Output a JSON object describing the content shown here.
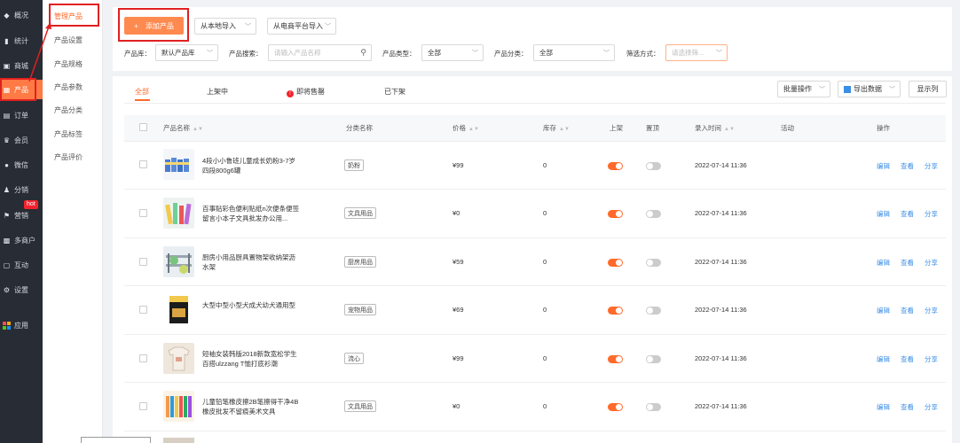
{
  "sidebar": {
    "items": [
      {
        "label": "概况",
        "icon": "layers-icon"
      },
      {
        "label": "统计",
        "icon": "chart-icon"
      },
      {
        "label": "商城",
        "icon": "store-icon"
      },
      {
        "label": "产品",
        "icon": "grid-icon",
        "active": true
      },
      {
        "label": "订单",
        "icon": "order-icon"
      },
      {
        "label": "会员",
        "icon": "crown-icon"
      },
      {
        "label": "微信",
        "icon": "wechat-icon"
      },
      {
        "label": "分销",
        "icon": "users-icon"
      },
      {
        "label": "营销",
        "icon": "flag-icon"
      },
      {
        "label": "多商户",
        "icon": "shop-icon"
      },
      {
        "label": "互动",
        "icon": "chat-icon"
      },
      {
        "label": "设置",
        "icon": "gear-icon"
      },
      {
        "label": "应用",
        "icon": "apps-icon"
      }
    ],
    "hot_badge": "hot"
  },
  "subnav": {
    "items": [
      "管理产品",
      "产品设置",
      "产品规格",
      "产品参数",
      "产品分类",
      "产品标签",
      "产品评价"
    ]
  },
  "toolbar": {
    "add_label": "添加产品",
    "import_local": "从本地导入",
    "import_ecommerce": "从电商平台导入"
  },
  "filters": {
    "library_label": "产品库：",
    "library_value": "默认产品库",
    "search_label": "产品搜索：",
    "search_placeholder": "请输入产品名称",
    "type_label": "产品类型：",
    "type_value": "全部",
    "category_label": "产品分类：",
    "category_value": "全部",
    "filter_label": "筛选方式：",
    "filter_placeholder": "请选择筛..."
  },
  "tabs": [
    "全部",
    "上架中",
    "即将售罄",
    "已下架"
  ],
  "actions": {
    "batch": "批量操作",
    "export": "导出数据",
    "columns": "显示列"
  },
  "table": {
    "headers": [
      "产品名称",
      "分类名称",
      "价格",
      "库存",
      "上架",
      "置顶",
      "录入时间",
      "活动",
      "操作"
    ],
    "rows": [
      {
        "name": "4段小小鲁班儿童成长奶粉3-7岁四段800g6罐",
        "category": "奶粉",
        "price": "¥99",
        "stock": "0",
        "listed": true,
        "pinned": false,
        "time": "2022-07-14 11:36",
        "thumb": "milk"
      },
      {
        "name": "百事贴彩色便利贴纸n次便条便签留言小本子文具批发办公用...",
        "category": "文具用品",
        "price": "¥0",
        "stock": "0",
        "listed": true,
        "pinned": false,
        "time": "2022-07-14 11:36",
        "thumb": "sticky"
      },
      {
        "name": "厨房小用品厨具置物架收纳架沥水架",
        "category": "厨房用品",
        "price": "¥59",
        "stock": "0",
        "listed": true,
        "pinned": false,
        "time": "2022-07-14 11:36",
        "thumb": "kitchen"
      },
      {
        "name": "大型中型小型犬成犬幼犬通用型",
        "category": "宠物用品",
        "price": "¥69",
        "stock": "0",
        "listed": true,
        "pinned": false,
        "time": "2022-07-14 11:36",
        "thumb": "petfood"
      },
      {
        "name": "短袖女装韩版2018新款宽松学生百搭ulzzang T恤打底衫潮",
        "category": "流心",
        "price": "¥99",
        "stock": "0",
        "listed": true,
        "pinned": false,
        "time": "2022-07-14 11:36",
        "thumb": "tshirt"
      },
      {
        "name": "儿童铅笔橡皮擦2B笔擦得干净4B橡皮批发不留痕美术文具",
        "category": "文具用品",
        "price": "¥0",
        "stock": "0",
        "listed": true,
        "pinned": false,
        "time": "2022-07-14 11:36",
        "thumb": "eraser"
      }
    ],
    "ops": [
      "编辑",
      "查看",
      "分享"
    ]
  },
  "colors": {
    "accent": "#ff6a2b",
    "link": "#3a8ee6",
    "sidebar_bg": "#282c34",
    "highlight_border": "#e02020"
  }
}
